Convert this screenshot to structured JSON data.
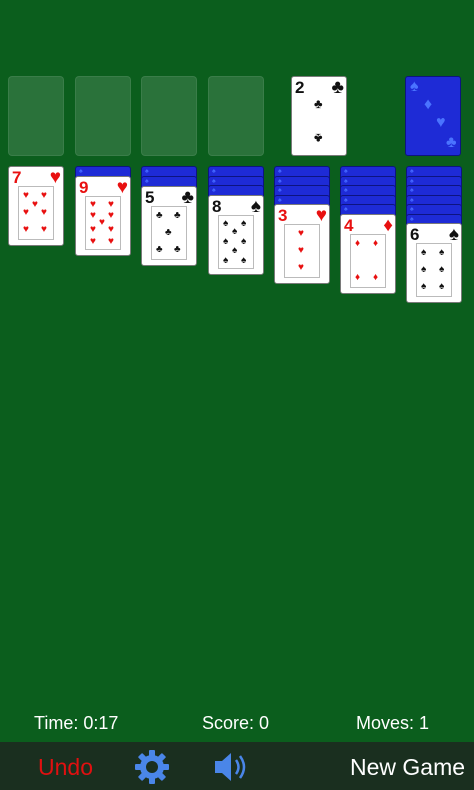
{
  "game": "Solitaire",
  "colors": {
    "table": "#0b5e1d",
    "card_back": "#1e2bd6",
    "red_suit": "#e81010",
    "black_suit": "#111111",
    "toolbar": "#1a2f1f",
    "undo": "#e01010"
  },
  "top_row": {
    "foundations": [
      "empty",
      "empty",
      "empty",
      "empty"
    ],
    "waste": {
      "rank": "2",
      "suit": "♣",
      "color": "black"
    },
    "stock": {
      "face": "down"
    }
  },
  "tableau": [
    {
      "hidden": 0,
      "face_up": {
        "rank": "7",
        "suit": "♥",
        "color": "red"
      }
    },
    {
      "hidden": 1,
      "face_up": {
        "rank": "9",
        "suit": "♥",
        "color": "red"
      }
    },
    {
      "hidden": 2,
      "face_up": {
        "rank": "5",
        "suit": "♣",
        "color": "black"
      }
    },
    {
      "hidden": 3,
      "face_up": {
        "rank": "8",
        "suit": "♠",
        "color": "black"
      }
    },
    {
      "hidden": 4,
      "face_up": {
        "rank": "3",
        "suit": "♥",
        "color": "red"
      }
    },
    {
      "hidden": 5,
      "face_up": {
        "rank": "4",
        "suit": "♦",
        "color": "red"
      }
    },
    {
      "hidden": 6,
      "face_up": {
        "rank": "6",
        "suit": "♠",
        "color": "black"
      }
    }
  ],
  "status": {
    "time": "Time: 0:17",
    "score": "Score: 0",
    "moves": "Moves: 1"
  },
  "toolbar": {
    "undo_label": "Undo",
    "settings_icon": "gear-icon",
    "sound_icon": "speaker-icon",
    "new_game_label": "New Game"
  }
}
